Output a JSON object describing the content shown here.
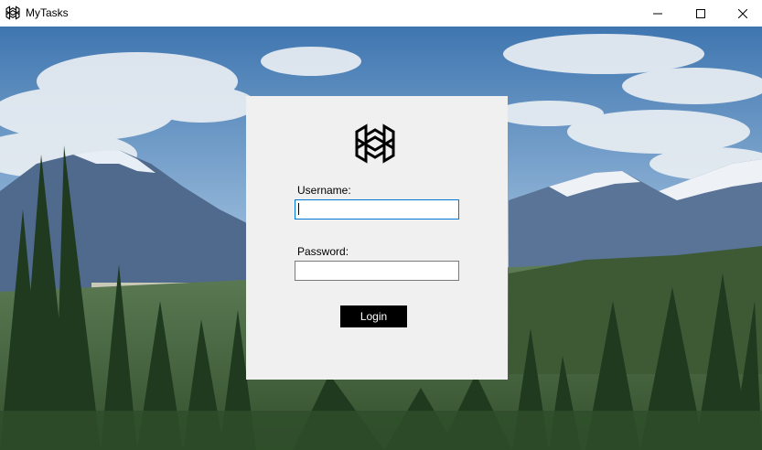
{
  "window": {
    "title": "MyTasks",
    "icon": "app-logo-icon",
    "controls": [
      "minimize-icon",
      "maximize-icon",
      "close-icon"
    ]
  },
  "background": {
    "description_icon": "mountain-landscape-image"
  },
  "login": {
    "logo_icon": "app-logo-icon",
    "username_label": "Username:",
    "username_value": "",
    "password_label": "Password:",
    "password_value": "",
    "login_button": "Login"
  },
  "colors": {
    "card_bg": "#f0f0f0",
    "focus_border": "#0078d7",
    "button_bg": "#000000",
    "button_text": "#ffffff"
  }
}
